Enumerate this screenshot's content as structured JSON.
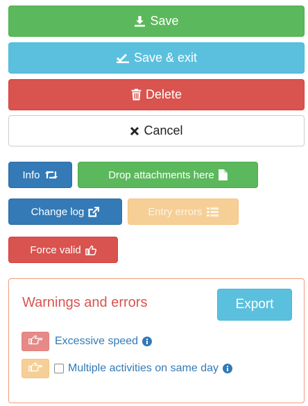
{
  "actions": {
    "save": "Save",
    "save_exit": "Save & exit",
    "delete": "Delete",
    "cancel": "Cancel"
  },
  "tools": {
    "info": "Info",
    "drop_attachments": "Drop attachments here",
    "change_log": "Change log",
    "entry_errors": "Entry errors",
    "force_valid": "Force valid"
  },
  "warnings": {
    "title": "Warnings and errors",
    "export": "Export",
    "items": [
      {
        "label": "Excessive speed",
        "badge_color": "#e58a87"
      },
      {
        "label": "Multiple activities on same day",
        "badge_color": "#f6cf96"
      }
    ]
  },
  "colors": {
    "success": "#5cb85c",
    "info": "#5bc0de",
    "danger": "#d9534f",
    "primary": "#337ab7",
    "warning_disabled": "#f6cf96"
  },
  "icons": {
    "save": "download-icon",
    "save_exit": "check-icon",
    "delete": "trash-icon",
    "cancel": "close-icon",
    "info": "retweet-icon",
    "drop_attachments": "file-icon",
    "change_log": "external-link-icon",
    "entry_errors": "list-icon",
    "force_valid": "thumbs-up-icon",
    "warning_item": "hand-pointer-icon",
    "info_circle": "info-circle-icon"
  }
}
